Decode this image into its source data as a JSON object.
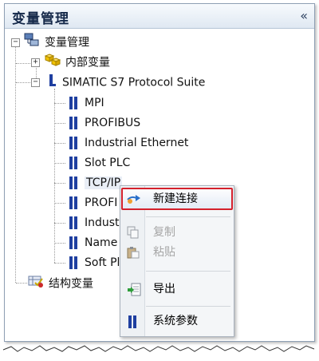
{
  "panel": {
    "title": "变量管理",
    "collapse_glyph": "«"
  },
  "tree": {
    "root": {
      "label": "变量管理",
      "expander": "−",
      "icon": "network-icon"
    },
    "internal": {
      "label": "内部变量",
      "expander": "+",
      "icon": "cubes-icon"
    },
    "protocol_suite": {
      "label": "SIMATIC S7 Protocol Suite",
      "expander": "−",
      "icon": "driver-icon"
    },
    "channels": [
      {
        "label": "MPI"
      },
      {
        "label": "PROFIBUS"
      },
      {
        "label": "Industrial Ethernet"
      },
      {
        "label": "Slot PLC"
      },
      {
        "label": "TCP/IP"
      },
      {
        "label": "PROFI"
      },
      {
        "label": "Indust"
      },
      {
        "label": "Name"
      },
      {
        "label": "Soft Pl"
      }
    ],
    "struct": {
      "label": "结构变量",
      "icon": "struct-icon"
    }
  },
  "context_menu": {
    "items": [
      {
        "label": "新建连接",
        "icon": "new-connection-icon",
        "enabled": true,
        "highlighted": true
      },
      {
        "label": "复制",
        "icon": "copy-icon",
        "enabled": false
      },
      {
        "label": "粘贴",
        "icon": "paste-icon",
        "enabled": false
      },
      {
        "label": "导出",
        "icon": "export-icon",
        "enabled": true
      },
      {
        "label": "系统参数",
        "icon": "system-params-icon",
        "enabled": true
      }
    ]
  },
  "colors": {
    "highlight_border": "#d4212c",
    "channel_icon": "#1f3fa0",
    "title_text": "#15294a"
  }
}
